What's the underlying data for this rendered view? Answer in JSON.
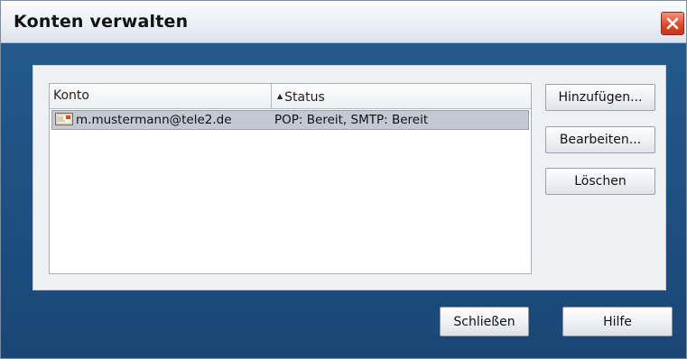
{
  "dialog": {
    "title": "Konten verwalten"
  },
  "list": {
    "columns": [
      {
        "label": "Konto"
      },
      {
        "label": "Status",
        "sorted": "ascending"
      }
    ],
    "rows": [
      {
        "account": "m.mustermann@tele2.de",
        "status": "POP: Bereit, SMTP: Bereit",
        "icon": "mail-account-icon",
        "selected": true
      }
    ]
  },
  "side_buttons": {
    "add_label": "Hinzufügen...",
    "edit_label": "Bearbeiten...",
    "delete_label": "Löschen"
  },
  "footer": {
    "close_label": "Schließen",
    "help_label": "Hilfe"
  },
  "colors": {
    "background": "#1d4e7e",
    "close_button": "#de4a2d",
    "selected_row": "#c3c8d2"
  }
}
